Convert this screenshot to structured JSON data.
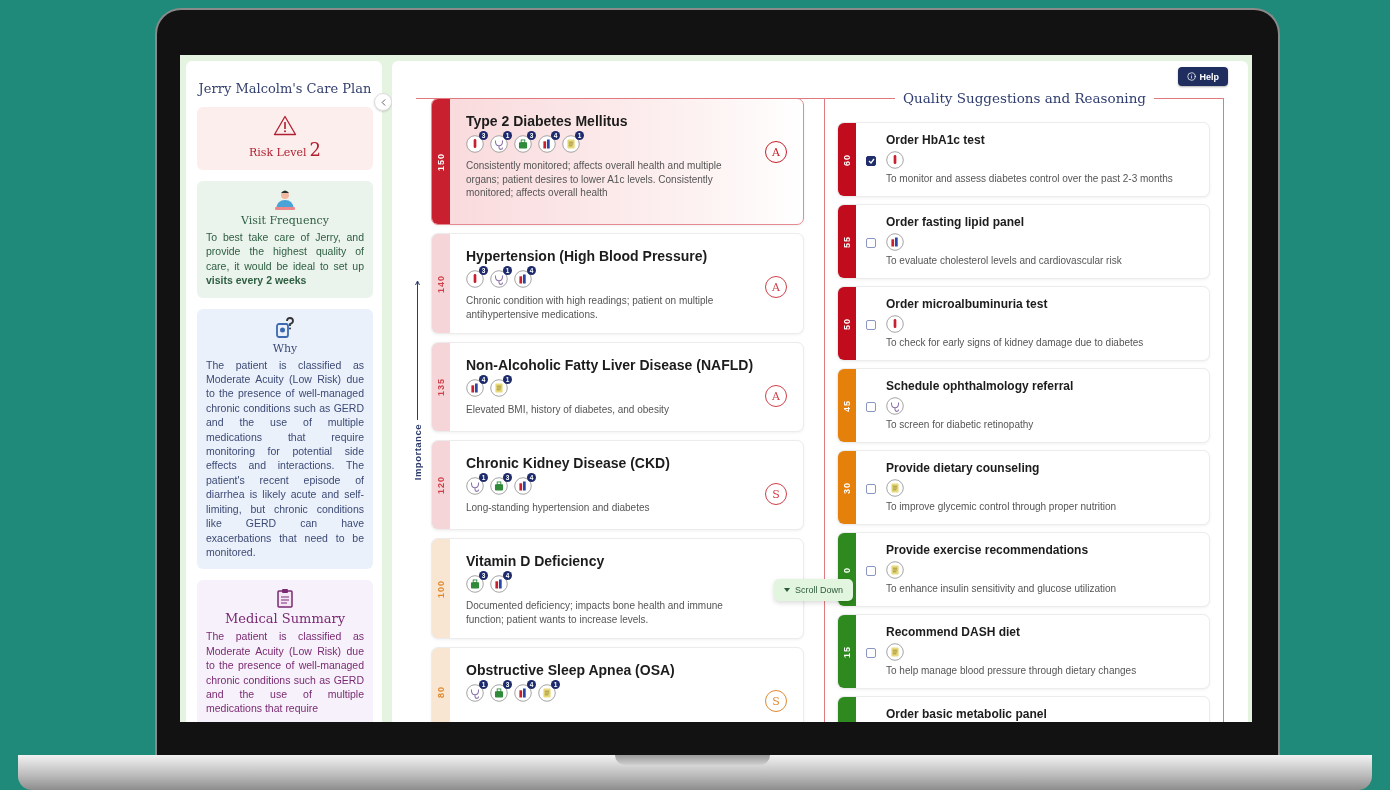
{
  "sidebar": {
    "title": "Jerry Malcolm's Care Plan",
    "risk": {
      "label": "Risk Level",
      "value": "2"
    },
    "cards": [
      {
        "kind": "visit",
        "title": "Visit Frequency",
        "text": "To best take care of Jerry, and provide the highest quality of care, it would be ideal to set up **visits every 2 weeks**"
      },
      {
        "kind": "why",
        "title": "Why",
        "text": "The patient is classified as Moderate Acuity (Low Risk) due to the presence of well-managed chronic conditions such as GERD and the use of multiple medications that require monitoring for potential side effects and interactions. The patient's recent episode of diarrhea is likely acute and self-limiting, but chronic conditions like GERD can have exacerbations that need to be monitored."
      },
      {
        "kind": "summary",
        "title": "Medical Summary",
        "text": "The patient is classified as Moderate Acuity (Low Risk) due to the presence of well-managed chronic conditions such as GERD and the use of multiple medications that require"
      }
    ]
  },
  "help_button": "Help",
  "importance_label": "Importance",
  "conditions": [
    {
      "score": "150",
      "color": "#c8202e",
      "selected": true,
      "title": "Type 2 Diabetes Mellitus",
      "icons": [
        {
          "kind": "lab",
          "count": "3"
        },
        {
          "kind": "referral",
          "count": "1"
        },
        {
          "kind": "medication",
          "count": "3"
        },
        {
          "kind": "vials",
          "count": "4"
        },
        {
          "kind": "note",
          "count": "1"
        }
      ],
      "description": "Consistently monitored; affects overall health and multiple organs; patient desires to lower A1c levels.  Consistently monitored; affects overall health",
      "category": "A"
    },
    {
      "score": "140",
      "color": "#d0404a",
      "selected": false,
      "title": "Hypertension (High Blood Pressure)",
      "icons": [
        {
          "kind": "lab",
          "count": "3"
        },
        {
          "kind": "referral",
          "count": "1"
        },
        {
          "kind": "vials",
          "count": "4"
        }
      ],
      "description": "Chronic condition with high readings; patient on multiple antihypertensive medications.",
      "category": "A"
    },
    {
      "score": "135",
      "color": "#d0404a",
      "selected": false,
      "title": "Non-Alcoholic Fatty Liver Disease (NAFLD)",
      "icons": [
        {
          "kind": "vials",
          "count": "4"
        },
        {
          "kind": "note",
          "count": "1"
        }
      ],
      "description": "Elevated BMI, history of diabetes, and obesity",
      "category": "A"
    },
    {
      "score": "120",
      "color": "#d0404a",
      "selected": false,
      "title": "Chronic Kidney Disease (CKD)",
      "icons": [
        {
          "kind": "referral",
          "count": "1"
        },
        {
          "kind": "medication",
          "count": "3"
        },
        {
          "kind": "vials",
          "count": "4"
        }
      ],
      "description": "Long-standing hypertension and diabetes",
      "category": "S"
    },
    {
      "score": "100",
      "color": "#e08a30",
      "selected": false,
      "title": "Vitamin D Deficiency",
      "icons": [
        {
          "kind": "medication",
          "count": "3"
        },
        {
          "kind": "vials",
          "count": "4"
        }
      ],
      "description": "Documented deficiency; impacts bone health and immune function; patient wants to increase levels."
    },
    {
      "score": "80",
      "color": "#e08a30",
      "selected": false,
      "title": "Obstructive Sleep Apnea (OSA)",
      "icons": [
        {
          "kind": "referral",
          "count": "1"
        },
        {
          "kind": "medication",
          "count": "3"
        },
        {
          "kind": "vials",
          "count": "4"
        },
        {
          "kind": "note",
          "count": "1"
        }
      ],
      "category": "S"
    }
  ],
  "scroll_hint": "Scroll Down",
  "suggestions": {
    "title": "Quality Suggestions and Reasoning",
    "items": [
      {
        "score": "60",
        "color": "#c10c1d",
        "checked": true,
        "title": "Order HbA1c test",
        "icons": [
          {
            "kind": "lab"
          }
        ],
        "description": "To monitor and assess diabetes control over the past 2-3 months"
      },
      {
        "score": "55",
        "color": "#c10c1d",
        "checked": false,
        "title": "Order fasting lipid panel",
        "icons": [
          {
            "kind": "vials"
          }
        ],
        "description": "To evaluate cholesterol levels and cardiovascular risk"
      },
      {
        "score": "50",
        "color": "#c10c1d",
        "checked": false,
        "title": "Order microalbuminuria test",
        "icons": [
          {
            "kind": "lab"
          }
        ],
        "description": "To check for early signs of kidney damage due to diabetes"
      },
      {
        "score": "45",
        "color": "#e5800b",
        "checked": false,
        "title": "Schedule ophthalmology referral",
        "icons": [
          {
            "kind": "referral"
          }
        ],
        "description": "To screen for diabetic retinopathy"
      },
      {
        "score": "30",
        "color": "#e5800b",
        "checked": false,
        "title": "Provide dietary counseling",
        "icons": [
          {
            "kind": "note"
          }
        ],
        "description": "To improve glycemic control through proper nutrition"
      },
      {
        "score": "0",
        "color": "#2e8a1e",
        "checked": false,
        "title": "Provide exercise recommendations",
        "icons": [
          {
            "kind": "note"
          }
        ],
        "description": "To enhance insulin sensitivity and glucose utilization"
      },
      {
        "score": "15",
        "color": "#2e8a1e",
        "checked": false,
        "title": "Recommend DASH diet",
        "icons": [
          {
            "kind": "note"
          }
        ],
        "description": "To help manage blood pressure through dietary changes"
      },
      {
        "color": "#2e8a1e",
        "title": "Order basic metabolic panel"
      }
    ]
  }
}
